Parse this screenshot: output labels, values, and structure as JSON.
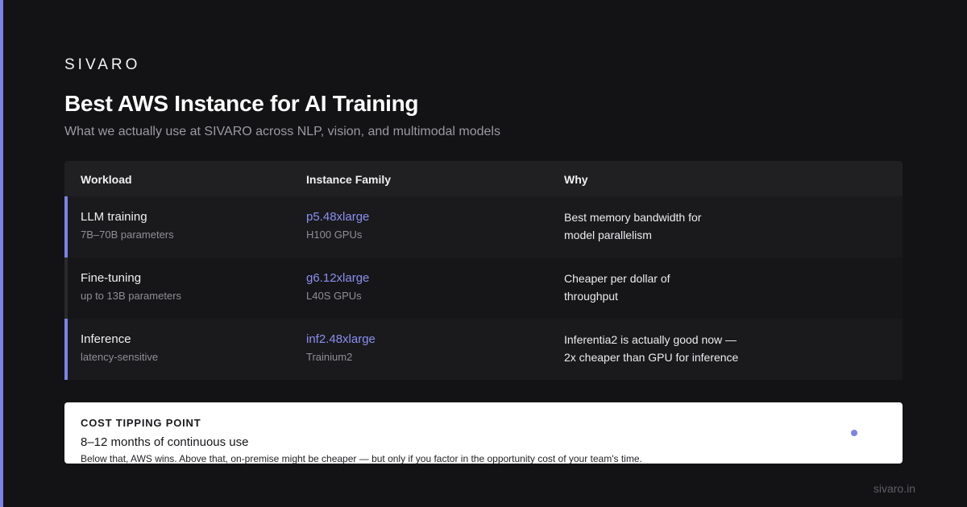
{
  "brand": "SIVARO",
  "title": "Best AWS Instance for AI Training",
  "subtitle": "What we actually use at SIVARO across NLP, vision, and multimodal models",
  "table": {
    "headers": [
      "Workload",
      "Instance Family",
      "Why"
    ],
    "rows": [
      {
        "workload": "LLM training",
        "workload_detail": "7B–70B parameters",
        "instance": "p5.48xlarge",
        "instance_detail": "H100 GPUs",
        "why_line1": "Best memory bandwidth for",
        "why_line2": "model parallelism"
      },
      {
        "workload": "Fine-tuning",
        "workload_detail": "up to 13B parameters",
        "instance": "g6.12xlarge",
        "instance_detail": "L40S GPUs",
        "why_line1": "Cheaper per dollar of",
        "why_line2": "throughput"
      },
      {
        "workload": "Inference",
        "workload_detail": "latency-sensitive",
        "instance": "inf2.48xlarge",
        "instance_detail": "Trainium2",
        "why_line1": "Inferentia2 is actually good now —",
        "why_line2": "2x cheaper than GPU for inference"
      }
    ]
  },
  "callout": {
    "label": "COST TIPPING POINT",
    "value": "8–12 months of continuous use",
    "note": "Below that, AWS wins. Above that, on-premise might be cheaper — but only if you factor in the opportunity cost of your team's time."
  },
  "footer": "sivaro.in",
  "colors": {
    "accent": "#7b82e8",
    "background": "#131315"
  }
}
